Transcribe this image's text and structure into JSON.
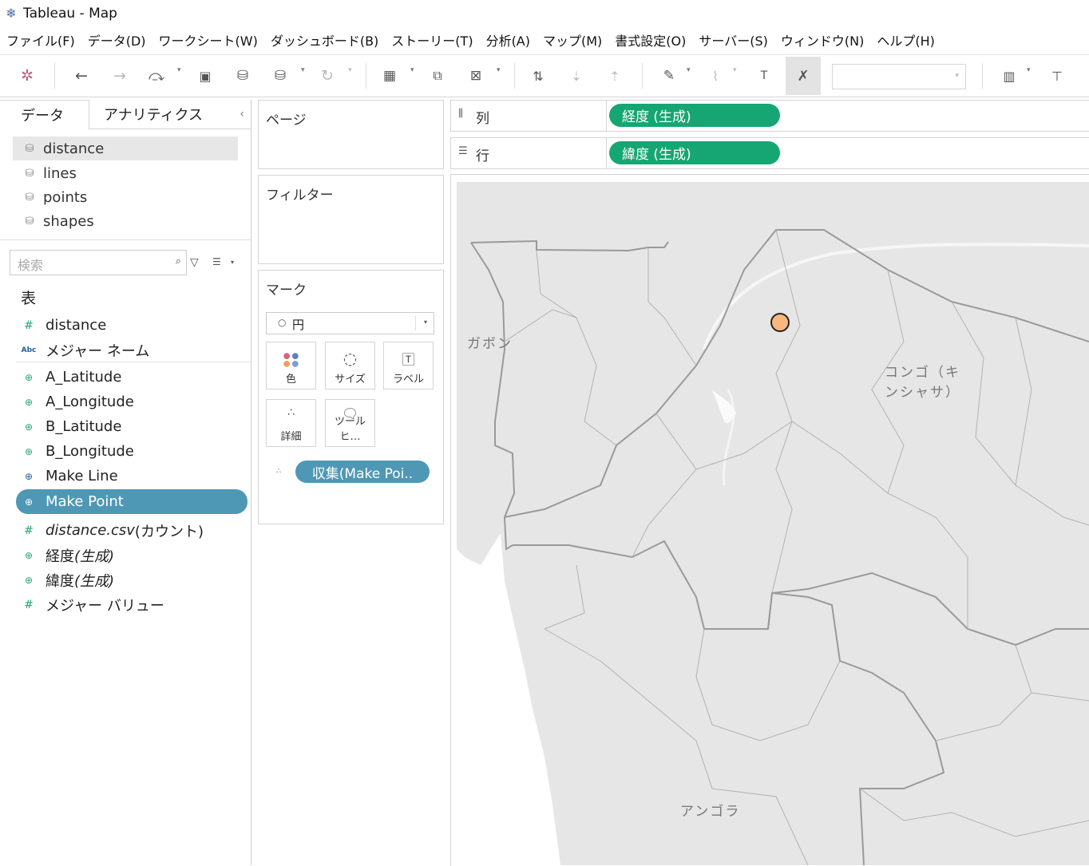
{
  "window": {
    "title": "Tableau - Map"
  },
  "menu": [
    "ファイル(F)",
    "データ(D)",
    "ワークシート(W)",
    "ダッシュボード(B)",
    "ストーリー(T)",
    "分析(A)",
    "マップ(M)",
    "書式設定(O)",
    "サーバー(S)",
    "ウィンドウ(N)",
    "ヘルプ(H)"
  ],
  "sidebar": {
    "tab_data": "データ",
    "tab_analytics": "アナリティクス",
    "datasources": [
      "distance",
      "lines",
      "points",
      "shapes"
    ],
    "search_placeholder": "検索",
    "table_heading": "表",
    "fields": [
      {
        "name": "distance"
      },
      {
        "name": "メジャー ネーム"
      },
      {
        "name": "A_Latitude"
      },
      {
        "name": "A_Longitude"
      },
      {
        "name": "B_Latitude"
      },
      {
        "name": "B_Longitude"
      },
      {
        "name": "Make Line"
      },
      {
        "name": "Make Point"
      },
      {
        "name": "distance.csv",
        "suffix": " (カウント)"
      },
      {
        "name": "経度",
        "suffix": " (生成)"
      },
      {
        "name": "緯度",
        "suffix": " (生成)"
      },
      {
        "name": "メジャー バリュー"
      }
    ],
    "icon_abc": "Abc",
    "icon_number": "#"
  },
  "cards": {
    "pages": "ページ",
    "filters": "フィルター",
    "marks": "マーク",
    "marks_type": "円",
    "mark_buttons": [
      {
        "label": "色",
        "icon": "color-dots-icon"
      },
      {
        "label": "サイズ",
        "icon": "size-icon"
      },
      {
        "label": "ラベル",
        "icon": "label-icon"
      },
      {
        "label": "詳細",
        "icon": "detail-icon"
      },
      {
        "label": "ツールヒ…",
        "icon": "tooltip-icon"
      }
    ],
    "marks_pill": "収集(Make Poi.."
  },
  "shelves": {
    "columns_label": "列",
    "columns_pill": "経度 (生成)",
    "rows_label": "行",
    "rows_pill": "緯度 (生成)"
  },
  "map": {
    "labels": [
      "ガボン",
      "コンゴ（キ",
      "ンシャサ）",
      "アンゴラ"
    ],
    "point_color": "#f8b77c"
  }
}
